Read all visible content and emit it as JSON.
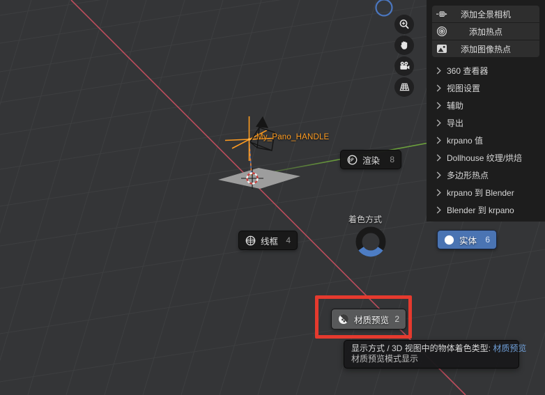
{
  "viewport": {
    "handle_label": "My_Pano_HANDLE",
    "colors": {
      "background": "#343537",
      "grid_line": "#3f4042",
      "x_axis_red": "#c44f5f",
      "y_axis_green": "#6ca13c",
      "selection_orange": "#ff9c20",
      "pie_selected_blue": "#4a74b3",
      "annotation_red": "#e53a2e",
      "tooltip_link_blue": "#6f9fd8"
    }
  },
  "nav_toolbar": {
    "icons": [
      "zoom-in",
      "pan-hand",
      "camera-view",
      "toggle-perspective-grid"
    ]
  },
  "sidebar": {
    "action_buttons": [
      {
        "icon": "pano-camera-icon",
        "label": "添加全景相机"
      },
      {
        "icon": "hotspot-rings-icon",
        "label": "添加热点"
      },
      {
        "icon": "image-hotspot-icon",
        "label": "添加图像热点"
      }
    ],
    "sections": [
      {
        "label": "360 查看器"
      },
      {
        "label": "视图设置"
      },
      {
        "label": "辅助"
      },
      {
        "label": "导出"
      },
      {
        "label": "krpano 值"
      },
      {
        "label": "Dollhouse 纹理/烘焙"
      },
      {
        "label": "多边形热点"
      },
      {
        "label": "krpano 到 Blender"
      },
      {
        "label": "Blender 到 krpano"
      }
    ]
  },
  "pie_menu": {
    "title": "着色方式",
    "items": [
      {
        "label": "渲染",
        "key": "8",
        "icon": "rendered-sphere-icon",
        "state": "normal"
      },
      {
        "label": "线框",
        "key": "4",
        "icon": "wireframe-sphere-icon",
        "state": "normal"
      },
      {
        "label": "实体",
        "key": "6",
        "icon": "solid-sphere-icon",
        "state": "selected"
      },
      {
        "label": "材质预览",
        "key": "2",
        "icon": "material-sphere-icon",
        "state": "hovered"
      }
    ]
  },
  "tooltip": {
    "line1_prefix": "显示方式 / 3D 视图中的物体着色类型: ",
    "line1_value": "材质预览",
    "line2": "材质预览模式显示"
  }
}
